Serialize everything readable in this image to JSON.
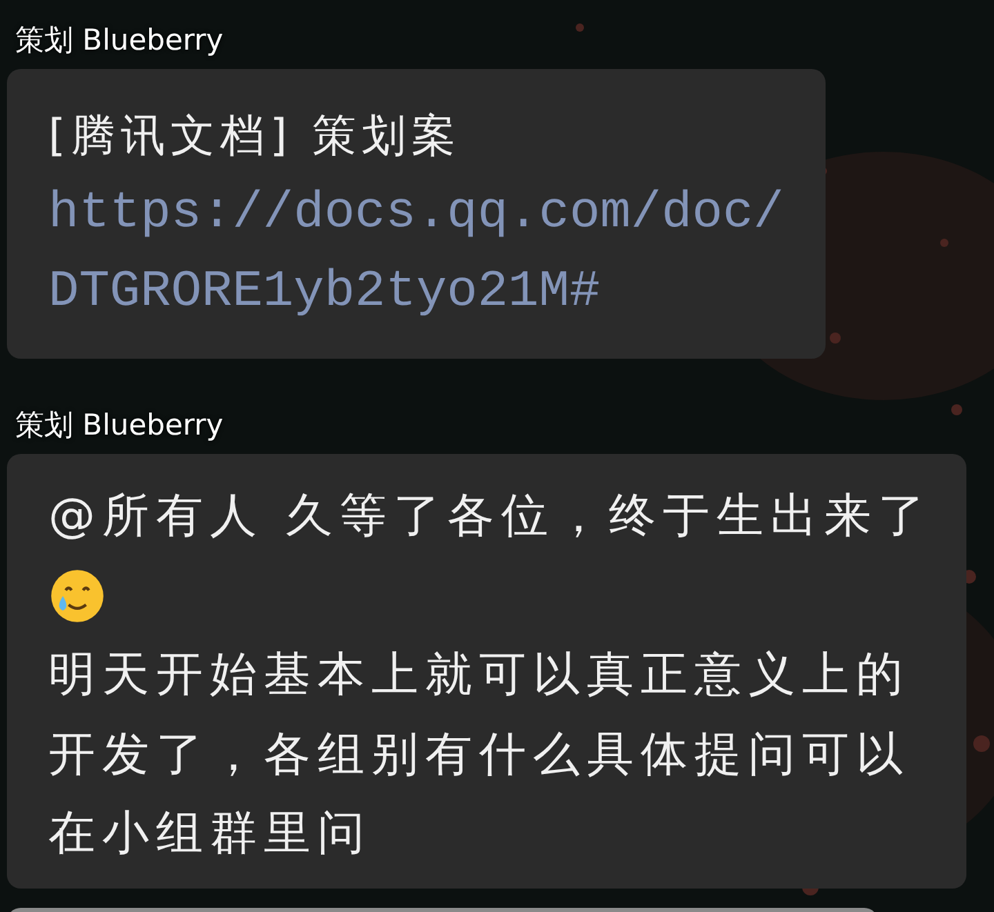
{
  "messages": [
    {
      "sender": "策划 Blueberry",
      "parts": [
        {
          "kind": "text",
          "text": "[腾讯文档] 策划案"
        },
        {
          "kind": "link",
          "text": "https://docs.qq.com/doc/DTGRORE1yb2tyo21M#"
        }
      ]
    },
    {
      "sender": "策划 Blueberry",
      "parts": [
        {
          "kind": "text",
          "text": "@所有人 久等了各位，终于生出来了"
        },
        {
          "kind": "emoji"
        },
        {
          "kind": "text",
          "text": "明天开始基本上就可以真正意义上的开发了，各组别有什么具体提问可以在小组群里问"
        }
      ]
    }
  ]
}
